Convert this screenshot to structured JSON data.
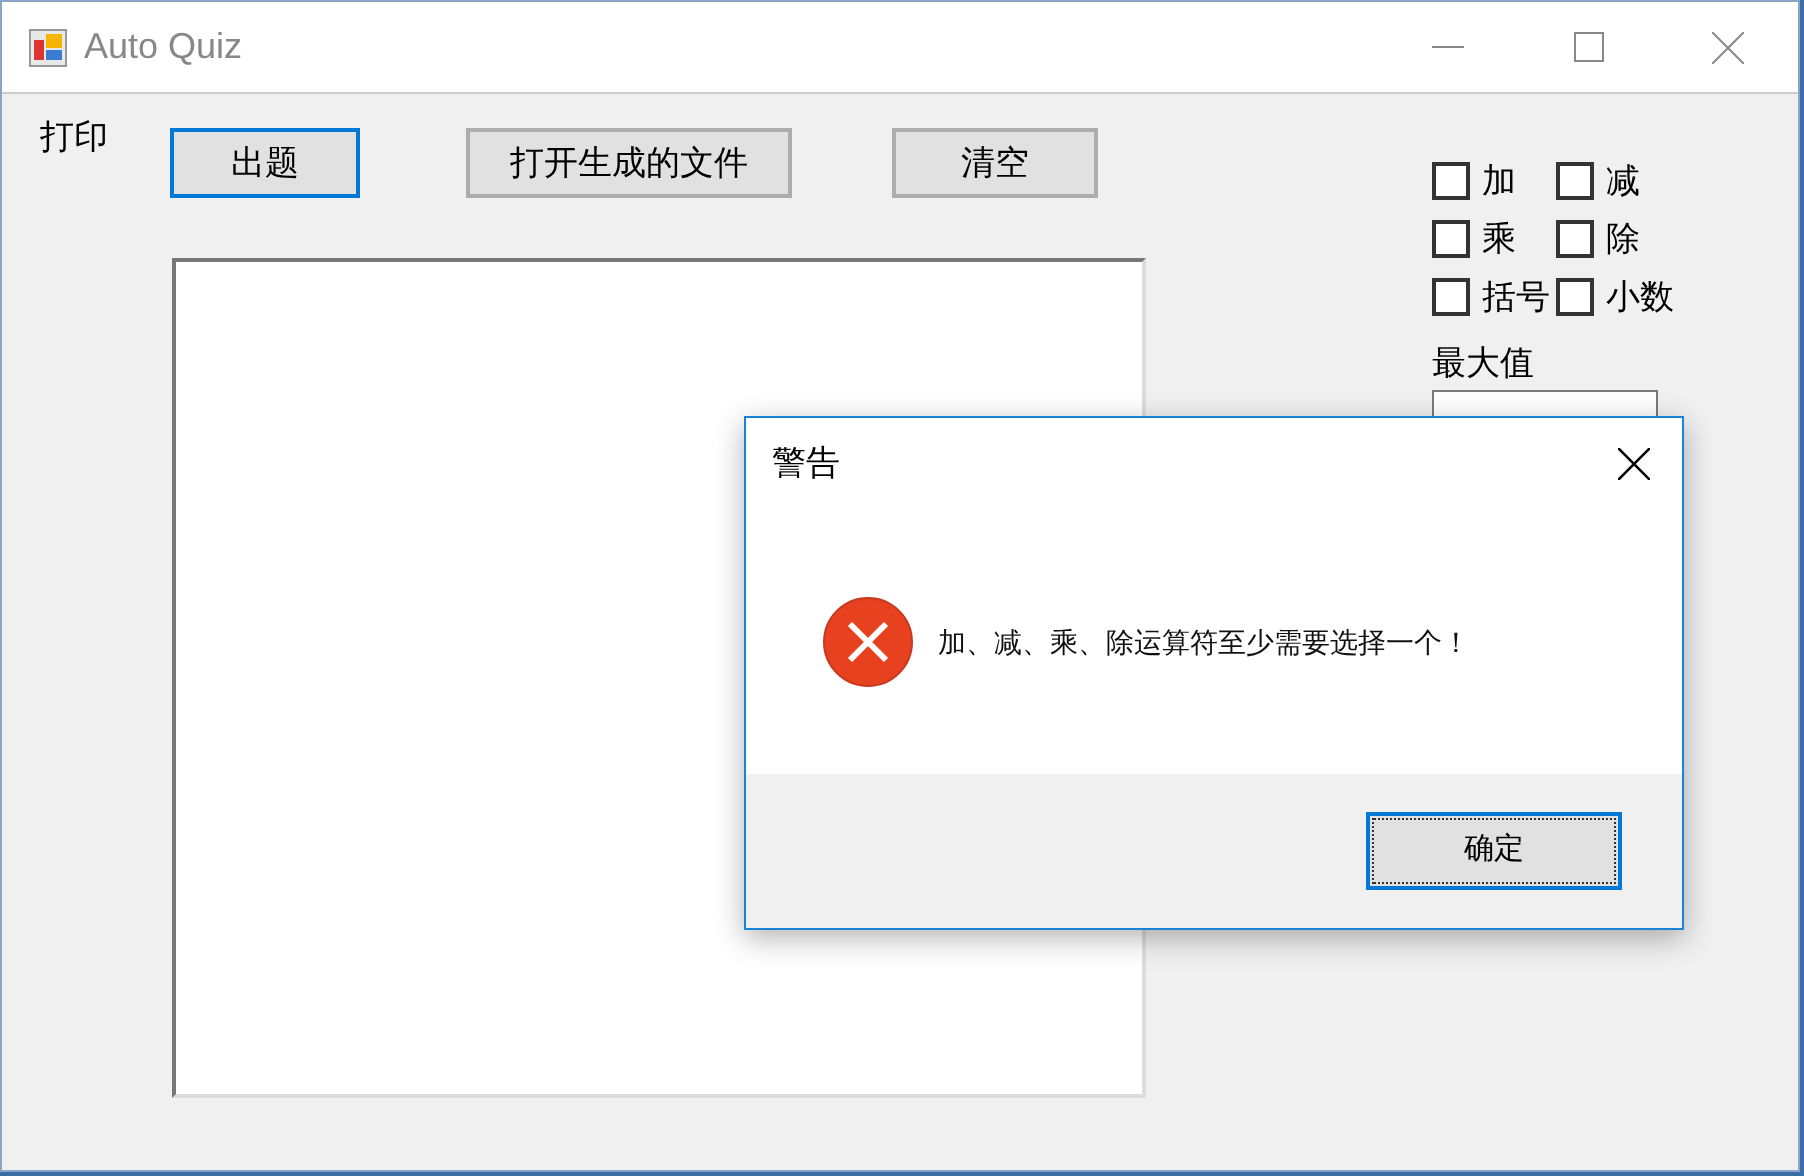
{
  "window": {
    "title": "Auto Quiz"
  },
  "menu": [
    "打印"
  ],
  "buttons": [
    {
      "label": "出题",
      "focused": true
    },
    {
      "label": "打开生成的文件",
      "focused": false
    },
    {
      "label": "清空",
      "focused": false
    }
  ],
  "options": [
    {
      "label": "加",
      "checked": false
    },
    {
      "label": "减",
      "checked": false
    },
    {
      "label": "乘",
      "checked": false
    },
    {
      "label": "除",
      "checked": false
    },
    {
      "label": "括号",
      "checked": false
    },
    {
      "label": "小数",
      "checked": false
    }
  ],
  "max_value": {
    "label": "最大值"
  },
  "dialog": {
    "title": "警告",
    "message": "加、减、乘、除运算符至少需要选择一个！",
    "buttons": [
      "确定"
    ]
  }
}
